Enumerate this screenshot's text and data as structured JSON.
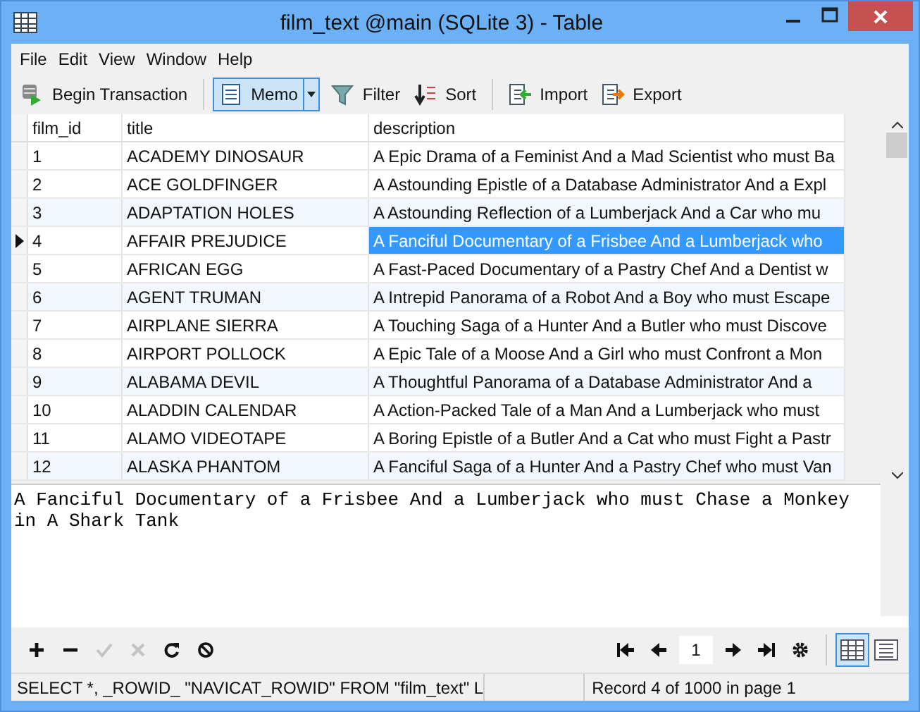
{
  "window": {
    "title": "film_text @main (SQLite 3) - Table"
  },
  "menu": [
    "File",
    "Edit",
    "View",
    "Window",
    "Help"
  ],
  "toolbar": [
    {
      "kind": "transaction",
      "label": "Begin Transaction",
      "selected": false
    },
    {
      "kind": "memo",
      "label": "Memo",
      "selected": true
    },
    {
      "kind": "filter",
      "label": "Filter",
      "selected": false
    },
    {
      "kind": "sort",
      "label": "Sort",
      "selected": false
    },
    {
      "kind": "import",
      "label": "Import",
      "selected": false
    },
    {
      "kind": "export",
      "label": "Export",
      "selected": false
    }
  ],
  "table": {
    "columns": [
      "film_id",
      "title",
      "description"
    ],
    "rows": [
      {
        "cells": [
          "1",
          "ACADEMY DINOSAUR",
          "A Epic Drama of a Feminist And a Mad Scientist who must Ba"
        ],
        "selected": false
      },
      {
        "cells": [
          "2",
          "ACE GOLDFINGER",
          "A Astounding Epistle of a Database Administrator And a Expl"
        ],
        "selected": false
      },
      {
        "cells": [
          "3",
          "ADAPTATION HOLES",
          "A Astounding Reflection of a Lumberjack And a Car who mu"
        ],
        "selected": false
      },
      {
        "cells": [
          "4",
          "AFFAIR PREJUDICE",
          "A Fanciful Documentary of a Frisbee And a Lumberjack who"
        ],
        "selected": true
      },
      {
        "cells": [
          "5",
          "AFRICAN EGG",
          "A Fast-Paced Documentary of a Pastry Chef And a Dentist w"
        ],
        "selected": false
      },
      {
        "cells": [
          "6",
          "AGENT TRUMAN",
          "A Intrepid Panorama of a Robot And a Boy who must Escape"
        ],
        "selected": false
      },
      {
        "cells": [
          "7",
          "AIRPLANE SIERRA",
          "A Touching Saga of a Hunter And a Butler who must Discove"
        ],
        "selected": false
      },
      {
        "cells": [
          "8",
          "AIRPORT POLLOCK",
          "A Epic Tale of a Moose And a Girl who must Confront a Mon"
        ],
        "selected": false
      },
      {
        "cells": [
          "9",
          "ALABAMA DEVIL",
          "A Thoughtful Panorama of a Database Administrator And a"
        ],
        "selected": false
      },
      {
        "cells": [
          "10",
          "ALADDIN CALENDAR",
          "A Action-Packed Tale of a Man And a Lumberjack who must"
        ],
        "selected": false
      },
      {
        "cells": [
          "11",
          "ALAMO VIDEOTAPE",
          "A Boring Epistle of a Butler And a Cat who must Fight a Pastr"
        ],
        "selected": false
      },
      {
        "cells": [
          "12",
          "ALASKA PHANTOM",
          "A Fanciful Saga of a Hunter And a Pastry Chef who must Van"
        ],
        "selected": false
      }
    ]
  },
  "memo": {
    "value": "A Fanciful Documentary of a Frisbee And a Lumberjack who must Chase a Monkey in A Shark Tank"
  },
  "record_tools": [
    {
      "kind": "add",
      "disabled": false
    },
    {
      "kind": "delete",
      "disabled": false
    },
    {
      "kind": "apply",
      "disabled": true
    },
    {
      "kind": "cancel",
      "disabled": true
    },
    {
      "kind": "refresh",
      "disabled": false
    },
    {
      "kind": "stop",
      "disabled": false
    }
  ],
  "pager": {
    "page": "1"
  },
  "views": [
    {
      "kind": "grid",
      "selected": true
    },
    {
      "kind": "form",
      "selected": false
    }
  ],
  "status_bar": {
    "query": "SELECT *, _ROWID_ \"NAVICAT_ROWID\" FROM \"film_text\" L",
    "record": "Record 4 of 1000 in page 1"
  }
}
